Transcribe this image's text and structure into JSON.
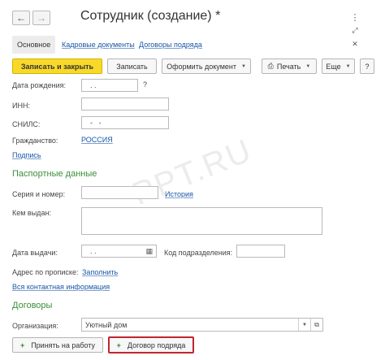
{
  "header": {
    "back_icon": "arrow-left-icon",
    "forward_icon": "arrow-right-icon",
    "title": "Сотрудник (создание) *",
    "more_icon": "vertical-dots-icon",
    "expand_icon": "expand-icon",
    "close_icon": "close-icon"
  },
  "tabs": [
    {
      "label": "Основное",
      "active": true
    },
    {
      "label": "Кадровые документы"
    },
    {
      "label": "Договоры подряда"
    }
  ],
  "toolbar": {
    "save_close": "Записать и закрыть",
    "save": "Записать",
    "create_doc": "Оформить документ",
    "print": "Печать",
    "more": "Еще",
    "help": "?"
  },
  "form": {
    "birth_date_label": "Дата рождения:",
    "birth_date_value": ". .",
    "birth_date_help": "?",
    "inn_label": "ИНН:",
    "snils_label": "СНИЛС:",
    "snils_value": "-   -",
    "citizenship_label": "Гражданство:",
    "citizenship_value": "РОССИЯ",
    "signature_link": "Подпись"
  },
  "passport": {
    "heading": "Паспортные данные",
    "series_label": "Серия и номер:",
    "history_link": "История",
    "issued_by_label": "Кем выдан:",
    "issue_date_label": "Дата выдачи:",
    "issue_date_value": ". .",
    "dept_code_label": "Код подразделения:"
  },
  "address": {
    "label": "Адрес по прописке:",
    "fill_link": "Заполнить",
    "all_contacts_link": "Вся контактная информация"
  },
  "contracts": {
    "heading": "Договоры",
    "org_label": "Организация:",
    "org_value": "Уютный дом",
    "hire_button": "Принять на работу",
    "contract_button": "Договор подряда"
  },
  "watermark": "PPT.RU",
  "colors": {
    "accent_yellow": "#f8d92a",
    "section_green": "#3a8f3a",
    "link_blue": "#1a57a8",
    "highlight_red": "#c0262d"
  }
}
